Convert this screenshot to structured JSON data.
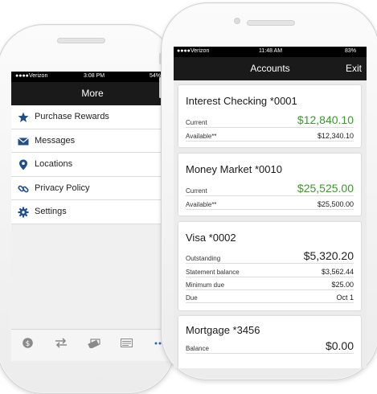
{
  "back_phone": {
    "status": {
      "carrier": "Verizon",
      "time": "3:08 PM",
      "battery": "54%"
    },
    "nav": {
      "title": "More",
      "right_action": "E"
    },
    "menu": [
      {
        "label": "Purchase Rewards",
        "icon": "star-icon"
      },
      {
        "label": "Messages",
        "icon": "envelope-icon"
      },
      {
        "label": "Locations",
        "icon": "map-pin-icon"
      },
      {
        "label": "Privacy Policy",
        "icon": "link-icon"
      },
      {
        "label": "Settings",
        "icon": "gear-icon"
      }
    ],
    "tabbar": [
      "dollar-icon",
      "transfer-icon",
      "deposit-icon",
      "bill-pay-icon",
      "more-icon"
    ]
  },
  "front_phone": {
    "status": {
      "carrier": "Verizon",
      "time": "11:48 AM",
      "battery": "83%"
    },
    "nav": {
      "title": "Accounts",
      "right_action": "Exit"
    },
    "accounts": [
      {
        "name": "Interest Checking *0001",
        "rows": [
          {
            "label": "Current",
            "value": "$12,840.10"
          },
          {
            "label": "Available**",
            "value": "$12,340.10"
          }
        ]
      },
      {
        "name": "Money Market *0010",
        "rows": [
          {
            "label": "Current",
            "value": "$25,525.00"
          },
          {
            "label": "Available**",
            "value": "$25,500.00"
          }
        ]
      },
      {
        "name": "Visa *0002",
        "rows": [
          {
            "label": "Outstanding",
            "value": "$5,320.20"
          },
          {
            "label": "Statement balance",
            "value": "$3,562.44"
          },
          {
            "label": "Minimum due",
            "value": "$25.00"
          },
          {
            "label": "Due",
            "value": "Oct 1"
          }
        ]
      },
      {
        "name": "Mortgage *3456",
        "rows": [
          {
            "label": "Balance",
            "value": "$0.00"
          }
        ]
      }
    ]
  },
  "colors": {
    "positive_balance": "#3a9a2a",
    "nav_bar": "#1a1a1a",
    "accent_icon": "#1f4e8c"
  }
}
